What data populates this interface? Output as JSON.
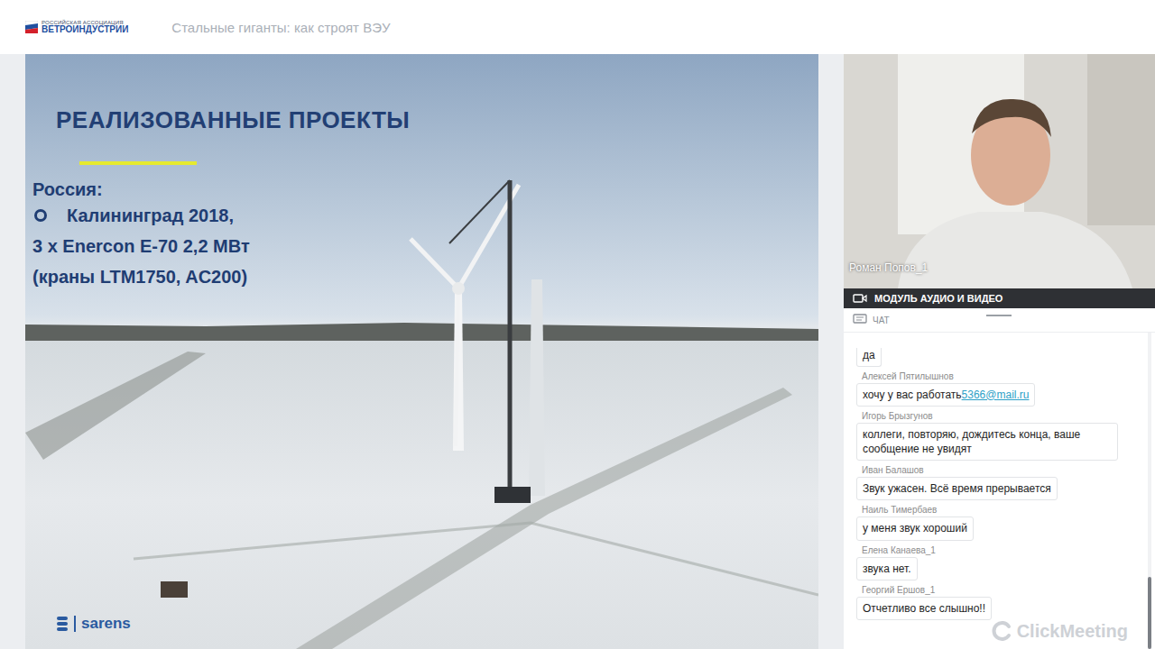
{
  "header": {
    "org_line1": "РОССИЙСКАЯ АССОЦИАЦИЯ",
    "org_line2": "ВЕТРОИНДУСТРИИ",
    "title": "Стальные гиганты: как строят ВЭУ"
  },
  "slide": {
    "title": "РЕАЛИЗОВАННЫЕ ПРОЕКТЫ",
    "country": "Россия:",
    "lines": [
      {
        "text": "Калининград 2018,",
        "bullet": true
      },
      {
        "text": "3 x Enercon E-70 2,2 МВт",
        "bullet": false
      },
      {
        "text": "(краны LTM1750, AC200)",
        "bullet": false
      }
    ],
    "logo": "sarens"
  },
  "video": {
    "presenter": "Роман Попов_1"
  },
  "module_bar": {
    "label": "МОДУЛЬ АУДИО И ВИДЕО"
  },
  "chat": {
    "label": "ЧАТ",
    "messages": [
      {
        "name": "",
        "text": "да",
        "partial": true
      },
      {
        "name": "Алексей Пятилышнов",
        "text": "хочу у вас работать",
        "link": "5366@mail.ru",
        "partial": false
      },
      {
        "name": "Игорь Брызгунов",
        "text": "коллеги, повторяю, дождитесь конца, ваше сообщение не увидят",
        "partial": false
      },
      {
        "name": "Иван Балашов",
        "text": "Звук ужасен. Всё время прерывается",
        "partial": false
      },
      {
        "name": "Наиль Тимербаев",
        "text": "у меня звук хороший",
        "partial": false
      },
      {
        "name": "Елена Канаева_1",
        "text": "звука нет.",
        "partial": false
      },
      {
        "name": "Георгий Ершов_1",
        "text": "Отчетливо все слышно!!",
        "partial": false
      }
    ]
  },
  "watermark": "ClickMeeting"
}
